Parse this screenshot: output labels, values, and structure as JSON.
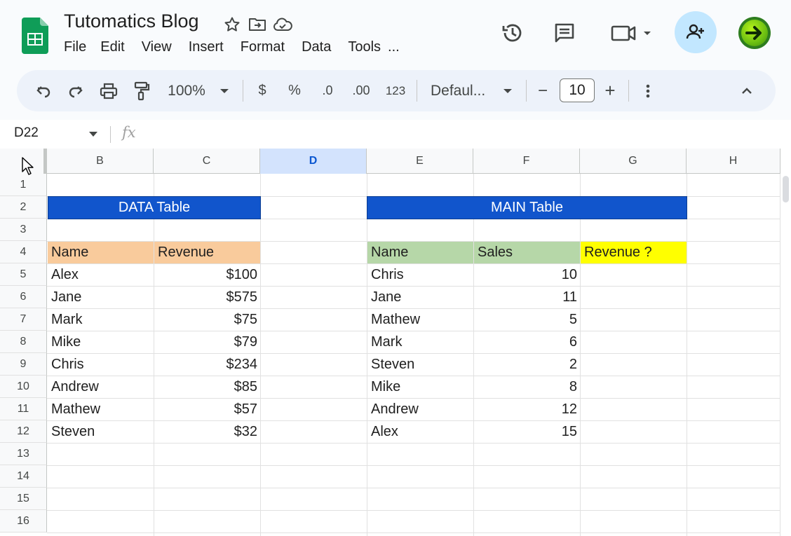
{
  "app": {
    "title": "Tutomatics Blog",
    "menu": [
      "File",
      "Edit",
      "View",
      "Insert",
      "Format",
      "Data",
      "Tools",
      "..."
    ]
  },
  "toolbar": {
    "zoom": "100%",
    "currency": "$",
    "percent": "%",
    "decrease_decimal": ".0",
    "increase_decimal": ".00",
    "more_formats": "123",
    "font": "Defaul...",
    "font_size": "10",
    "minus": "−",
    "plus": "+"
  },
  "formula_bar": {
    "cell_ref": "D22",
    "fx": "fx",
    "value": ""
  },
  "sheet": {
    "columns": [
      "B",
      "C",
      "D",
      "E",
      "F",
      "G",
      "H"
    ],
    "active_column": "D",
    "rows": [
      "1",
      "2",
      "3",
      "4",
      "5",
      "6",
      "7",
      "8",
      "9",
      "10",
      "11",
      "12",
      "13",
      "14",
      "15",
      "16"
    ],
    "data_table": {
      "title": "DATA Table",
      "headers": [
        "Name",
        "Revenue"
      ],
      "rows": [
        [
          "Alex",
          "$100"
        ],
        [
          "Jane",
          "$575"
        ],
        [
          "Mark",
          "$75"
        ],
        [
          "Mike",
          "$79"
        ],
        [
          "Chris",
          "$234"
        ],
        [
          "Andrew",
          "$85"
        ],
        [
          "Mathew",
          "$57"
        ],
        [
          "Steven",
          "$32"
        ]
      ]
    },
    "main_table": {
      "title": "MAIN  Table",
      "headers": [
        "Name",
        "Sales",
        "Revenue ?"
      ],
      "rows": [
        [
          "Chris",
          "10"
        ],
        [
          "Jane",
          "11"
        ],
        [
          "Mathew",
          "5"
        ],
        [
          "Mark",
          "6"
        ],
        [
          "Steven",
          "2"
        ],
        [
          "Mike",
          "8"
        ],
        [
          "Andrew",
          "12"
        ],
        [
          "Alex",
          "15"
        ]
      ]
    }
  },
  "colors": {
    "banner": "#1155cc",
    "data_header": "#f9cb9c",
    "main_header": "#b6d7a8",
    "highlight": "#ffff00",
    "share_button": "#c2e7ff"
  }
}
